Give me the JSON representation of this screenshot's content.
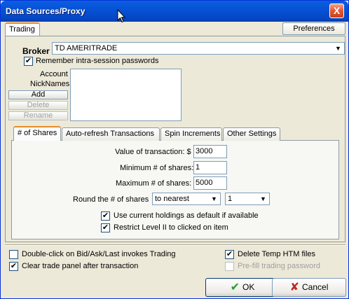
{
  "window": {
    "title": "Data Sources/Proxy",
    "close_label": "X"
  },
  "top": {
    "tab_label": "Trading",
    "preferences_label": "Preferences"
  },
  "broker": {
    "label": "Broker",
    "value": "TD AMERITRADE",
    "remember_label": "Remember intra-session passwords",
    "remember_checked": true
  },
  "nicknames": {
    "label_line1": "Account",
    "label_line2": "NickNames",
    "add_label": "Add",
    "delete_label": "Delete",
    "rename_label": "Rename"
  },
  "tabs": [
    {
      "label": "# of Shares",
      "active": true
    },
    {
      "label": "Auto-refresh Transactions",
      "active": false
    },
    {
      "label": "Spin Increments",
      "active": false
    },
    {
      "label": "Other Settings",
      "active": false
    }
  ],
  "shares": {
    "value_label": "Value of transaction: $",
    "value": "3000",
    "min_label": "Minimum # of shares:",
    "min": "1",
    "max_label": "Maximum # of shares:",
    "max": "5000",
    "round_label": "Round the # of shares",
    "round_mode": "to nearest",
    "round_value": "1",
    "use_holdings_label": "Use current holdings as default if available",
    "use_holdings_checked": true,
    "restrict_label": "Restrict Level II to clicked on item",
    "restrict_checked": true
  },
  "bottom": {
    "doubleclick_label": "Double-click on Bid/Ask/Last invokes Trading",
    "doubleclick_checked": false,
    "clear_label": "Clear trade panel after transaction",
    "clear_checked": true,
    "delete_temp_label": "Delete Temp HTM files",
    "delete_temp_checked": true,
    "prefill_label": "Pre-fill trading password",
    "prefill_checked": false
  },
  "buttons": {
    "ok_label": "OK",
    "cancel_label": "Cancel"
  },
  "icons": {
    "checkmark": "✔",
    "ok_icon": "check-icon",
    "cancel_icon": "x-icon",
    "dropdown": "chevron-down-icon"
  },
  "colors": {
    "title_bar": "#0a5fe0",
    "ok_check": "#2a9d2a",
    "cancel_x": "#c0282a",
    "tab_accent": "#e68b2c"
  }
}
